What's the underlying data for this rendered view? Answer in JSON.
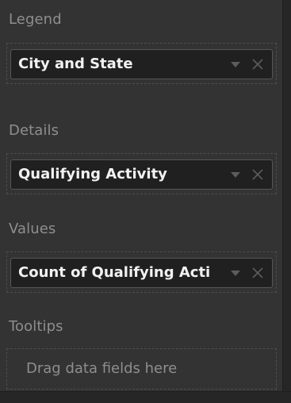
{
  "sections": [
    {
      "label": "Legend",
      "field": "City and State"
    },
    {
      "label": "Details",
      "field": "Qualifying Activity"
    },
    {
      "label": "Values",
      "field": "Count of Qualifying Acti"
    },
    {
      "label": "Tooltips",
      "placeholder": "Drag data fields here"
    }
  ],
  "icons": {
    "chevron": "chevron-down-icon",
    "close": "close-icon"
  },
  "colors": {
    "pane_bg": "#333333",
    "chip_bg": "#202020",
    "label_text": "#8e8e8e",
    "field_text": "#f2f2f2"
  }
}
